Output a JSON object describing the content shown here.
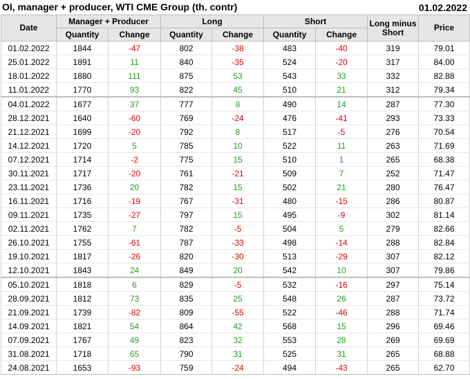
{
  "title": "OI, manager + producer, WTI CME Group (th. contr)",
  "date": "01.02.2022",
  "headers": {
    "date": "Date",
    "mp": "Manager + Producer",
    "long": "Long",
    "short": "Short",
    "lms": "Long minus Short",
    "price": "Price",
    "quantity": "Quantity",
    "change": "Change"
  },
  "colors": {
    "negative": "#e00000",
    "positive": "#1ea01e",
    "header_bg": "#e6e6e6"
  },
  "rows": [
    {
      "date": "01.02.2022",
      "mp_q": "1844",
      "mp_c": "-47",
      "l_q": "802",
      "l_c": "-38",
      "s_q": "483",
      "s_c": "-40",
      "lms": "319",
      "price": "79.01"
    },
    {
      "date": "25.01.2022",
      "mp_q": "1891",
      "mp_c": "11",
      "l_q": "840",
      "l_c": "-35",
      "s_q": "524",
      "s_c": "-20",
      "lms": "317",
      "price": "84.00"
    },
    {
      "date": "18.01.2022",
      "mp_q": "1880",
      "mp_c": "111",
      "l_q": "875",
      "l_c": "53",
      "s_q": "543",
      "s_c": "33",
      "lms": "332",
      "price": "82.88"
    },
    {
      "date": "11.01.2022",
      "mp_q": "1770",
      "mp_c": "93",
      "l_q": "822",
      "l_c": "45",
      "s_q": "510",
      "s_c": "21",
      "lms": "312",
      "price": "79.34"
    },
    {
      "date": "04.01.2022",
      "mp_q": "1677",
      "mp_c": "37",
      "l_q": "777",
      "l_c": "8",
      "s_q": "490",
      "s_c": "14",
      "lms": "287",
      "price": "77.30"
    },
    {
      "date": "28.12.2021",
      "mp_q": "1640",
      "mp_c": "-60",
      "l_q": "769",
      "l_c": "-24",
      "s_q": "476",
      "s_c": "-41",
      "lms": "293",
      "price": "73.33"
    },
    {
      "date": "21.12.2021",
      "mp_q": "1699",
      "mp_c": "-20",
      "l_q": "792",
      "l_c": "8",
      "s_q": "517",
      "s_c": "-5",
      "lms": "276",
      "price": "70.54"
    },
    {
      "date": "14.12.2021",
      "mp_q": "1720",
      "mp_c": "5",
      "l_q": "785",
      "l_c": "10",
      "s_q": "522",
      "s_c": "11",
      "lms": "263",
      "price": "71.69"
    },
    {
      "date": "07.12.2021",
      "mp_q": "1714",
      "mp_c": "-2",
      "l_q": "775",
      "l_c": "15",
      "s_q": "510",
      "s_c": "1",
      "lms": "265",
      "price": "68.38"
    },
    {
      "date": "30.11.2021",
      "mp_q": "1717",
      "mp_c": "-20",
      "l_q": "761",
      "l_c": "-21",
      "s_q": "509",
      "s_c": "7",
      "lms": "252",
      "price": "71.47"
    },
    {
      "date": "23.11.2021",
      "mp_q": "1736",
      "mp_c": "20",
      "l_q": "782",
      "l_c": "15",
      "s_q": "502",
      "s_c": "21",
      "lms": "280",
      "price": "76.47"
    },
    {
      "date": "16.11.2021",
      "mp_q": "1716",
      "mp_c": "-19",
      "l_q": "767",
      "l_c": "-31",
      "s_q": "480",
      "s_c": "-15",
      "lms": "286",
      "price": "80.87"
    },
    {
      "date": "09.11.2021",
      "mp_q": "1735",
      "mp_c": "-27",
      "l_q": "797",
      "l_c": "15",
      "s_q": "495",
      "s_c": "-9",
      "lms": "302",
      "price": "81.14"
    },
    {
      "date": "02.11.2021",
      "mp_q": "1762",
      "mp_c": "7",
      "l_q": "782",
      "l_c": "-5",
      "s_q": "504",
      "s_c": "5",
      "lms": "279",
      "price": "82.66"
    },
    {
      "date": "26.10.2021",
      "mp_q": "1755",
      "mp_c": "-61",
      "l_q": "787",
      "l_c": "-33",
      "s_q": "498",
      "s_c": "-14",
      "lms": "288",
      "price": "82.84"
    },
    {
      "date": "19.10.2021",
      "mp_q": "1817",
      "mp_c": "-26",
      "l_q": "820",
      "l_c": "-30",
      "s_q": "513",
      "s_c": "-29",
      "lms": "307",
      "price": "82.12"
    },
    {
      "date": "12.10.2021",
      "mp_q": "1843",
      "mp_c": "24",
      "l_q": "849",
      "l_c": "20",
      "s_q": "542",
      "s_c": "10",
      "lms": "307",
      "price": "79.86"
    },
    {
      "date": "05.10.2021",
      "mp_q": "1818",
      "mp_c": "6",
      "l_q": "829",
      "l_c": "-5",
      "s_q": "532",
      "s_c": "-16",
      "lms": "297",
      "price": "75.14"
    },
    {
      "date": "28.09.2021",
      "mp_q": "1812",
      "mp_c": "73",
      "l_q": "835",
      "l_c": "25",
      "s_q": "548",
      "s_c": "26",
      "lms": "287",
      "price": "73.72"
    },
    {
      "date": "21.09.2021",
      "mp_q": "1739",
      "mp_c": "-82",
      "l_q": "809",
      "l_c": "-55",
      "s_q": "522",
      "s_c": "-46",
      "lms": "288",
      "price": "71.74"
    },
    {
      "date": "14.09.2021",
      "mp_q": "1821",
      "mp_c": "54",
      "l_q": "864",
      "l_c": "42",
      "s_q": "568",
      "s_c": "15",
      "lms": "296",
      "price": "69.46"
    },
    {
      "date": "07.09.2021",
      "mp_q": "1767",
      "mp_c": "49",
      "l_q": "823",
      "l_c": "32",
      "s_q": "553",
      "s_c": "28",
      "lms": "269",
      "price": "69.69"
    },
    {
      "date": "31.08.2021",
      "mp_q": "1718",
      "mp_c": "65",
      "l_q": "790",
      "l_c": "31",
      "s_q": "525",
      "s_c": "31",
      "lms": "265",
      "price": "68.88"
    },
    {
      "date": "24.08.2021",
      "mp_q": "1653",
      "mp_c": "-93",
      "l_q": "759",
      "l_c": "-24",
      "s_q": "494",
      "s_c": "-43",
      "lms": "265",
      "price": "62.70"
    }
  ]
}
